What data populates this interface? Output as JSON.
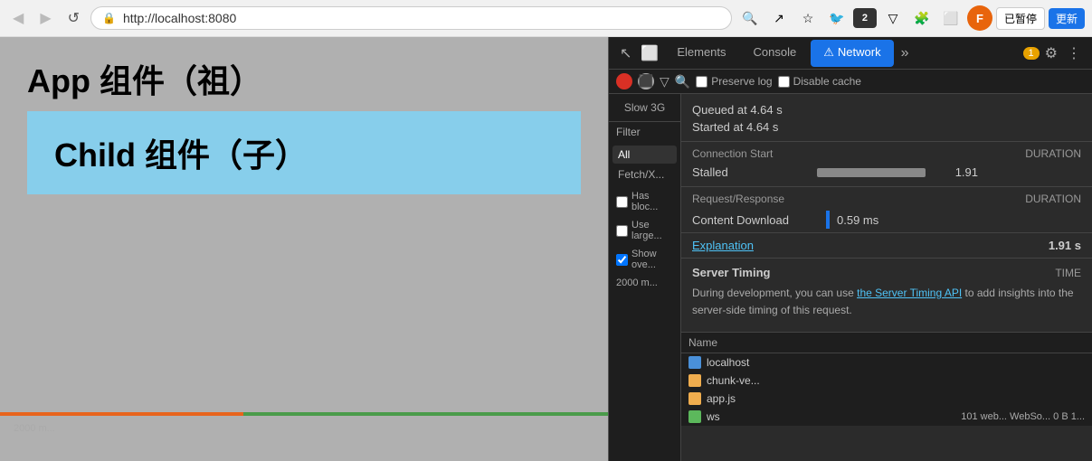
{
  "browser": {
    "url": "http://localhost:8080",
    "nav_back": "◀",
    "nav_forward": "▶",
    "nav_reload": "↺",
    "paused_label": "已暂停",
    "update_label": "更新",
    "lock_icon": "🔒"
  },
  "page": {
    "app_title": "App 组件（祖）",
    "child_title": "Child 组件（子）"
  },
  "devtools": {
    "tabs": [
      "Elements",
      "Console",
      "Network"
    ],
    "active_tab": "Network",
    "more_icon": "»",
    "badge_count": "1",
    "settings_icon": "⚙",
    "menu_icon": "⋮"
  },
  "network_toolbar": {
    "preserve_log_label": "Preserve log",
    "disable_cache_label": "Disable cache",
    "slow3g_label": "Slow 3G"
  },
  "filters": {
    "filter_label": "Filter",
    "all_label": "All",
    "fetchxhr_label": "Fetch/X...",
    "has_blocked_label": "Has bloc...",
    "use_large_label": "Use large...",
    "show_overview_label": "Show ove..."
  },
  "timing": {
    "queued_text": "Queued at 4.64 s",
    "started_text": "Started at 4.64 s",
    "connection_start_label": "Connection Start",
    "duration_label": "DURATION",
    "stalled_label": "Stalled",
    "stalled_value": "1.91",
    "request_response_label": "Request/Response",
    "duration_label2": "DURATION",
    "content_download_label": "Content Download",
    "content_download_value": "0.59 ms",
    "explanation_label": "Explanation",
    "total_value": "1.91 s",
    "server_timing_title": "Server Timing",
    "time_col": "TIME",
    "server_timing_text": "During development, you can use ",
    "server_timing_link": "the Server Timing API",
    "server_timing_text2": " to add insights into the server-side timing of this request."
  },
  "name_list": {
    "header": "Name",
    "items": [
      {
        "label": "localhost",
        "icon_color": "#4a90d9",
        "type": "page"
      },
      {
        "label": "chunk-ve...",
        "icon_color": "#f0ad4e",
        "type": "js"
      },
      {
        "label": "app.js",
        "icon_color": "#f0ad4e",
        "type": "js"
      },
      {
        "label": "ws",
        "icon_color": "#5cb85c",
        "type": "ws",
        "cols": "101  web...  WebSo...  0 B  1..."
      }
    ]
  }
}
